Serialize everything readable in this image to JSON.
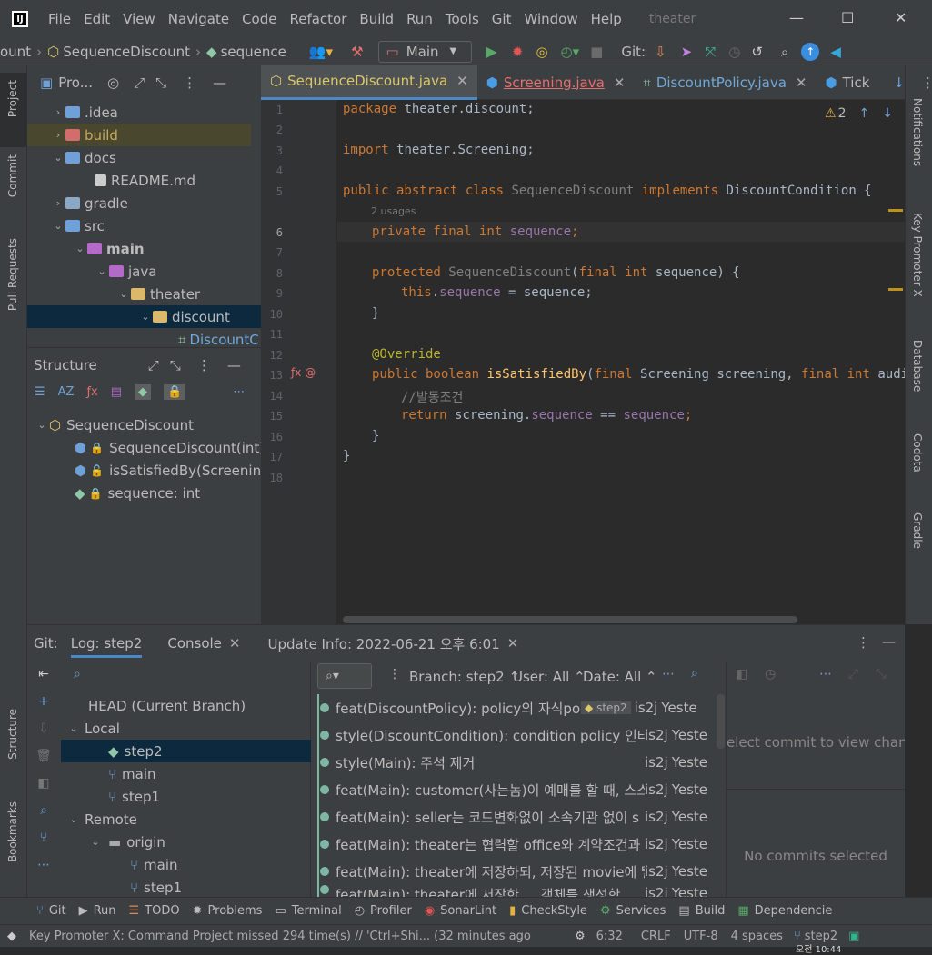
{
  "menubar": {
    "items": [
      "File",
      "Edit",
      "View",
      "Navigate",
      "Code",
      "Refactor",
      "Build",
      "Run",
      "Tools",
      "Git",
      "Window",
      "Help"
    ],
    "window_title": "theater",
    "controls": [
      "—",
      "☐",
      "✕"
    ]
  },
  "navbar": {
    "crumb_prefix": "ount",
    "crumb_class": "SequenceDiscount",
    "crumb_member": "sequence",
    "run_config": "Main",
    "git_label": "Git:"
  },
  "left_strip": {
    "project": "Project",
    "commit": "Commit",
    "pull_requests": "Pull Requests",
    "structure": "Structure",
    "bookmarks": "Bookmarks"
  },
  "right_strip": {
    "notifications": "Notifications",
    "key_promoter": "Key Promoter X",
    "database": "Database",
    "codota": "Codota",
    "gradle": "Gradle"
  },
  "project": {
    "title": "Pro...",
    "rows": [
      ".idea",
      "build",
      "docs",
      "README.md",
      "gradle",
      "src",
      "main",
      "java",
      "theater",
      "discount",
      "DiscountC"
    ]
  },
  "structure": {
    "title": "Structure",
    "rows": [
      "SequenceDiscount",
      "SequenceDiscount(int)",
      "isSatisfiedBy(Screening,",
      "sequence: int"
    ]
  },
  "editor": {
    "tabs": [
      "SequenceDiscount.java",
      "Screening.java",
      "DiscountPolicy.java",
      "Tick"
    ],
    "warning_count": "2",
    "line_numbers": [
      "1",
      "2",
      "3",
      "4",
      "5",
      "6",
      "7",
      "8",
      "9",
      "10",
      "11",
      "12",
      "13",
      "14",
      "15",
      "16",
      "17",
      "18"
    ],
    "usages_hint": "2 usages",
    "code": {
      "l1a": "package ",
      "l1b": "theater.discount;",
      "l3a": "import ",
      "l3b": "theater.Screening;",
      "l5a": "public abstract class ",
      "l5b": "SequenceDiscount ",
      "l5c": "implements ",
      "l5d": "DiscountCondition {",
      "l6a": "private final int ",
      "l6b": "sequence",
      "l6c": ";",
      "l8a": "protected ",
      "l8b": "SequenceDiscount",
      "l8c": "(",
      "l8d": "final int ",
      "l8e": "sequence) {",
      "l9a": "this",
      "l9b": ".",
      "l9c": "sequence",
      "l9d": " = sequence;",
      "l10": "}",
      "l12": "@Override",
      "l13a": "public boolean ",
      "l13b": "isSatisfiedBy",
      "l13c": "(",
      "l13d": "final ",
      "l13e": "Screening screening, ",
      "l13f": "final int ",
      "l13g": "audienc",
      "l14": "//발동조건",
      "l15a": "return ",
      "l15b": "screening.",
      "l15c": "sequence",
      "l15d": " == ",
      "l15e": "sequence",
      "l15f": ";",
      "l16": "}",
      "l17": "}"
    }
  },
  "bottom": {
    "tabs": {
      "git": "Git:",
      "log": "Log: step2",
      "console": "Console",
      "update": "Update Info: 2022-06-21 오후 6:01"
    },
    "branch_tree": [
      "HEAD (Current Branch)",
      "Local",
      "step2",
      "main",
      "step1",
      "Remote",
      "origin",
      "main",
      "step1"
    ],
    "filters": {
      "branch": "Branch: step2",
      "user": "User: All",
      "date": "Date: All"
    },
    "commits": [
      {
        "msg": "feat(DiscountPolicy): policy의 자식polic",
        "tag": "step2",
        "author": "is2j",
        "date": "Yeste"
      },
      {
        "msg": "style(DiscountCondition): condition policy 인터페",
        "author": "is2j",
        "date": "Yeste"
      },
      {
        "msg": "style(Main): 주석 제거",
        "author": "is2j",
        "date": "Yeste"
      },
      {
        "msg": "feat(Main): customer(사는놈)이 예매를 할 때, 스스",
        "author": "is2j",
        "date": "Yeste"
      },
      {
        "msg": "feat(Main): seller는 코드변화없이 소속기관 없이 s",
        "author": "is2j",
        "date": "Yeste"
      },
      {
        "msg": "feat(Main): theater는 협력할 office와 계약조건과",
        "author": "is2j",
        "date": "Yeste"
      },
      {
        "msg": "feat(Main): theater에 저장하되, 저장된 movie에 뛜",
        "author": "is2j",
        "date": "Yeste"
      },
      {
        "msg": "feat(Main): theater에 저장한 ... 객체를 생성함",
        "author": "is2j",
        "date": "Yeste"
      }
    ],
    "details_top": "elect commit to view change",
    "details_bottom": "No commits selected"
  },
  "toolwindows": [
    "Git",
    "Run",
    "TODO",
    "Problems",
    "Terminal",
    "Profiler",
    "SonarLint",
    "CheckStyle",
    "Services",
    "Build",
    "Dependencie"
  ],
  "statusbar": {
    "message": "Key Promoter X: Command Project missed 294 time(s) // 'Ctrl+Shi... (32 minutes ago",
    "position": "6:32",
    "line_sep": "CRLF",
    "encoding": "UTF-8",
    "indent": "4 spaces",
    "branch": "step2",
    "clock": "오전 10:44"
  }
}
